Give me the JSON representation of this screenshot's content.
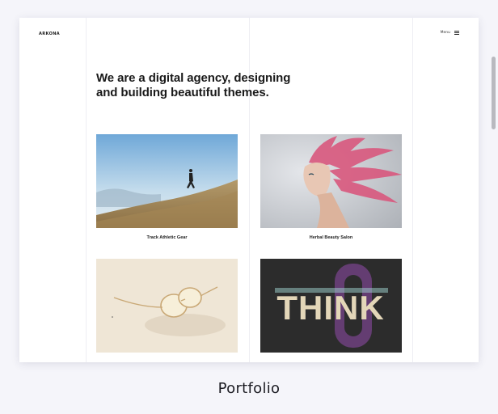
{
  "site": {
    "logo": "ARKONA",
    "menu_label": "Menu"
  },
  "hero": {
    "line1": "We are a digital agency, designing",
    "line2": "and building beautiful themes."
  },
  "portfolio_items": [
    {
      "title": "Track Athletic Gear"
    },
    {
      "title": "Herbal Beauty Salon"
    },
    {
      "title": "",
      "image_text": ""
    },
    {
      "title": "",
      "image_text": "THINK"
    }
  ],
  "footer_caption": "Portfolio",
  "colors": {
    "background": "#f5f5fa",
    "text": "#1a1a1a",
    "hair": "#d9587e",
    "think_accent": "#7a4a8a"
  }
}
